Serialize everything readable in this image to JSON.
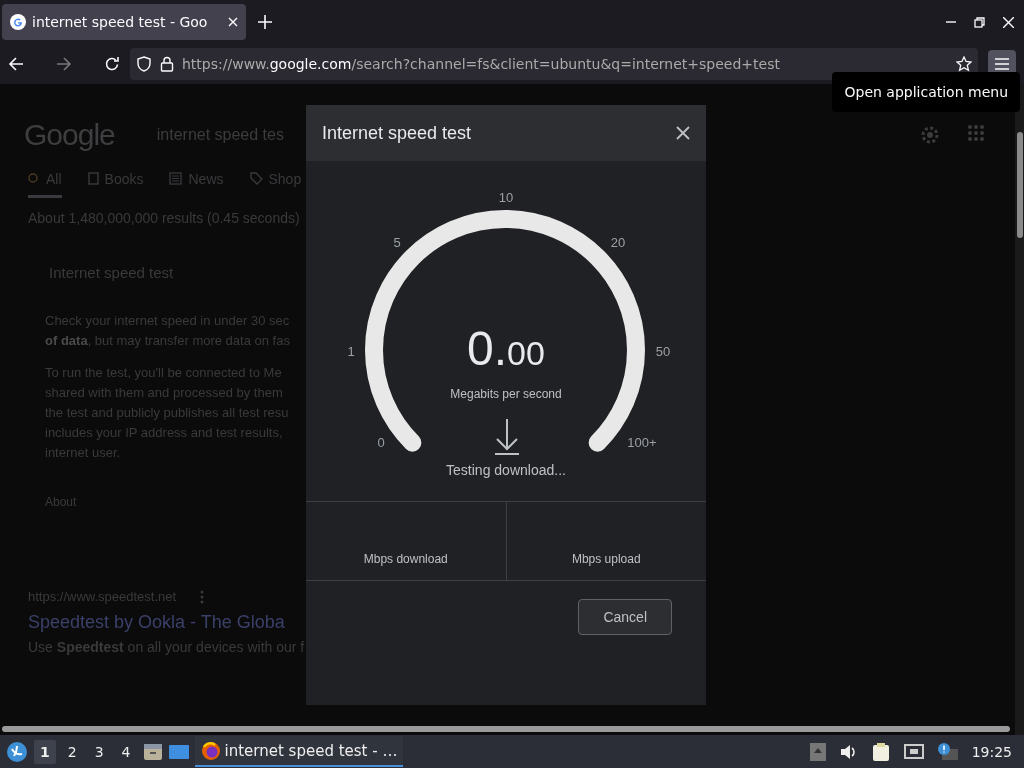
{
  "browser": {
    "tabs": [
      {
        "title": "internet speed test - Goo",
        "selected": true
      }
    ],
    "url": "https://www.**google.com**/search?channel=fs&client=ubuntu&q=internet+speed+test",
    "tooltip": "Open application menu"
  },
  "page": {
    "logo": "Google",
    "search_value": "internet speed tes",
    "tabs": [
      {
        "label": "All",
        "selected": true
      },
      {
        "label": "Books",
        "selected": false
      },
      {
        "label": "News",
        "selected": false
      },
      {
        "label": "Shop",
        "selected": false
      }
    ],
    "result_stats": "About 1,480,000,000 results (0.45 seconds)",
    "widget": {
      "title": "Internet speed test",
      "paragraphs": [
        [
          "Check your internet speed in under 30 sec",
          "**of data**, but may transfer more data on fas"
        ],
        [
          "To run the test, you'll be connected to Me",
          "shared with them and processed by them",
          "the test and publicly publishes all test resu",
          "includes your IP address and test results,",
          "internet user."
        ]
      ],
      "link": "About"
    },
    "results": [
      {
        "url": "https://www.speedtest.net",
        "title": "Speedtest by Ookla - The Globa",
        "snippet": "Use **Speedtest** on all your devices with our f"
      }
    ]
  },
  "dialog": {
    "title": "Internet speed test",
    "ticks": [
      "0",
      "1",
      "5",
      "10",
      "20",
      "50",
      "100+"
    ],
    "reading": "0.00",
    "unit": "Megabits per second",
    "status": "Testing download...",
    "stats": [
      "Mbps download",
      "Mbps upload"
    ],
    "cancel": "Cancel"
  },
  "taskbar": {
    "workspaces": [
      {
        "label": "1",
        "selected": true
      },
      {
        "label": "2",
        "selected": false
      },
      {
        "label": "3",
        "selected": false
      },
      {
        "label": "4",
        "selected": false
      }
    ],
    "tasks": [
      {
        "title": "internet speed test - …",
        "selected": true
      }
    ],
    "clock": "19:25"
  }
}
